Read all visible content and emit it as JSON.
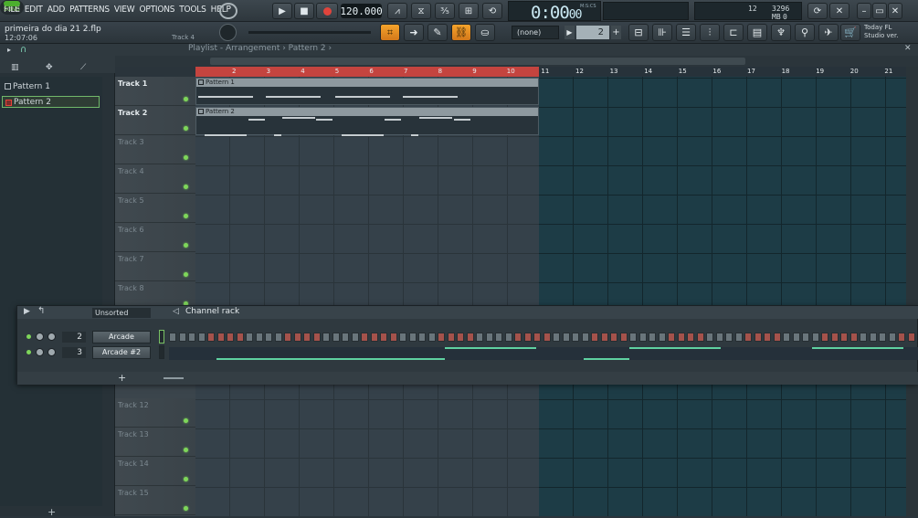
{
  "menu": [
    "FILE",
    "EDIT",
    "ADD",
    "PATTERNS",
    "VIEW",
    "OPTIONS",
    "TOOLS",
    "HELP"
  ],
  "transport": {
    "song_label": "SONG",
    "tempo": "120.000",
    "time": "0:00",
    "time_sub": "00",
    "time_unit": "M:S:CS"
  },
  "stats": {
    "cpu": "12",
    "memory": "3296 MB",
    "polyphony": "0"
  },
  "project": {
    "name": "primeira do dia 21 2.flp",
    "time": "12:07:06",
    "track_indicator": "Track 4"
  },
  "toolbar": {
    "pattern_selector": "(none)",
    "pattern_number": "2",
    "news_line1": "Today  FL",
    "news_line2": "Studio ver."
  },
  "browser": {
    "items": [
      {
        "label": "Pattern 1"
      },
      {
        "label": "Pattern 2"
      }
    ]
  },
  "playlist": {
    "breadcrumb": "Playlist - Arrangement › Pattern 2 ›",
    "ruler": [
      "2",
      "3",
      "4",
      "5",
      "6",
      "7",
      "8",
      "9",
      "10",
      "11",
      "12",
      "13",
      "14",
      "15",
      "16",
      "17",
      "18",
      "19",
      "20",
      "21"
    ],
    "tracks": [
      "Track 1",
      "Track 2",
      "Track 3",
      "Track 4",
      "Track 5",
      "Track 6",
      "Track 7",
      "Track 8",
      "Track 12",
      "Track 13",
      "Track 14",
      "Track 15"
    ],
    "clips": [
      {
        "label": "Pattern 1"
      },
      {
        "label": "Pattern 2"
      }
    ]
  },
  "rack": {
    "filter": "Unsorted",
    "title": "Channel rack",
    "channels": [
      {
        "number": "2",
        "name": "Arcade"
      },
      {
        "number": "3",
        "name": "Arcade #2"
      }
    ]
  },
  "colors": {
    "accent_orange": "#f5a32c",
    "loop_red": "#c4443f",
    "led_green": "#7ed65a",
    "note_teal": "#5fd1a1"
  }
}
